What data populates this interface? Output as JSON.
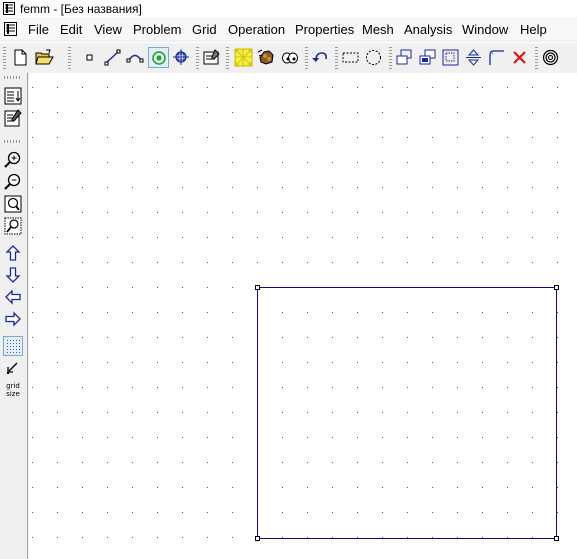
{
  "window": {
    "title": "femm - [Без названия]",
    "app_icon": "femm-app-icon"
  },
  "menu": {
    "doc_icon": "document-icon",
    "items": [
      "File",
      "Edit",
      "View",
      "Problem",
      "Grid",
      "Operation",
      "Properties",
      "Mesh",
      "Analysis",
      "Window",
      "Help"
    ]
  },
  "toolbar": {
    "buttons": [
      {
        "name": "new-document",
        "icon": "new-file-icon"
      },
      {
        "name": "open-document",
        "icon": "open-folder-icon"
      },
      {
        "name": "operate-on-nodes",
        "icon": "node-icon"
      },
      {
        "name": "operate-on-segments",
        "icon": "segment-icon"
      },
      {
        "name": "operate-on-arcs",
        "icon": "arc-icon"
      },
      {
        "name": "operate-on-block-labels",
        "icon": "block-label-icon",
        "pressed": true
      },
      {
        "name": "operate-on-groups",
        "icon": "group-icon"
      },
      {
        "name": "edit-properties",
        "icon": "properties-icon"
      },
      {
        "name": "create-mesh",
        "icon": "mesh-icon"
      },
      {
        "name": "run-analysis",
        "icon": "run-analysis-icon"
      },
      {
        "name": "view-results",
        "icon": "view-results-icon"
      },
      {
        "name": "undo",
        "icon": "undo-icon"
      },
      {
        "name": "select-window",
        "icon": "select-rectangle-icon"
      },
      {
        "name": "select-circle",
        "icon": "select-circle-icon"
      },
      {
        "name": "move-objects",
        "icon": "move-icon"
      },
      {
        "name": "copy-objects",
        "icon": "copy-icon"
      },
      {
        "name": "scale-objects",
        "icon": "scale-icon"
      },
      {
        "name": "mirror-objects",
        "icon": "mirror-icon"
      },
      {
        "name": "create-fillet",
        "icon": "fillet-icon"
      },
      {
        "name": "delete-objects",
        "icon": "delete-icon"
      },
      {
        "name": "create-open-boundary",
        "icon": "open-boundary-icon"
      }
    ]
  },
  "left_toolbar": {
    "buttons": [
      {
        "name": "show-block-names",
        "icon": "show-names-icon"
      },
      {
        "name": "edit-notes",
        "icon": "notes-icon"
      },
      {
        "name": "zoom-in",
        "icon": "zoom-in-icon"
      },
      {
        "name": "zoom-out",
        "icon": "zoom-out-icon"
      },
      {
        "name": "zoom-natural",
        "icon": "zoom-natural-icon"
      },
      {
        "name": "zoom-window",
        "icon": "zoom-window-icon"
      },
      {
        "name": "pan-up",
        "icon": "arrow-up-icon"
      },
      {
        "name": "pan-down",
        "icon": "arrow-down-icon"
      },
      {
        "name": "pan-left",
        "icon": "arrow-left-icon"
      },
      {
        "name": "pan-right",
        "icon": "arrow-right-icon"
      },
      {
        "name": "show-grid",
        "icon": "grid-icon",
        "pressed": true
      },
      {
        "name": "snap-to-grid",
        "icon": "snap-grid-icon"
      },
      {
        "name": "set-grid-size",
        "icon": "grid-size-icon",
        "text": "grid\nsize"
      }
    ]
  },
  "colors": {
    "geometry_line": "#0a0a8c",
    "grid_dot": "#555555",
    "canvas_bg": "#ffffff",
    "pressed_bg": "#e3eef8",
    "pressed_border": "#7aa7d6"
  }
}
